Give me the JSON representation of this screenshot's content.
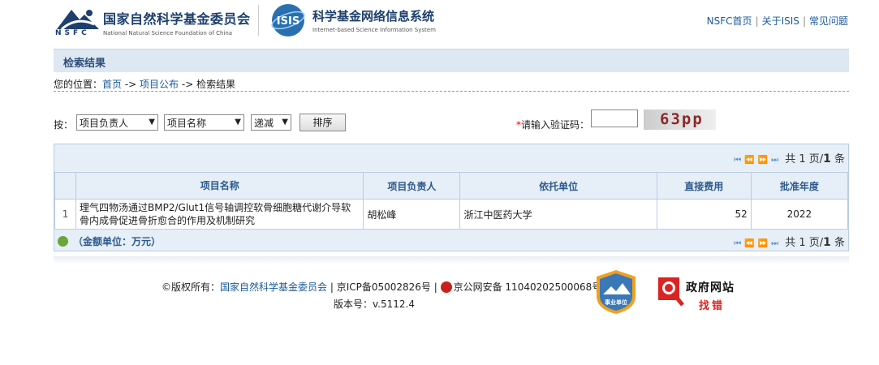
{
  "header": {
    "nsfc_tag": "NSFC",
    "logo1_cn": "国家自然科学基金委员会",
    "logo1_en": "National Natural Science Foundation of China",
    "logo2_cn": "科学基金网络信息系统",
    "logo2_en": "Internet-based Science Information System",
    "logo2_mark": "ISIS",
    "nav": [
      "NSFC首页",
      "关于ISIS",
      "常见问题"
    ]
  },
  "titlebar": "检索结果",
  "breadcrumb": {
    "prefix": "您的位置：",
    "home": "首页",
    "sep1": " -> ",
    "section": "项目公布",
    "sep2": " -> ",
    "current": "检索结果"
  },
  "sort": {
    "label": "按：",
    "select1": "项目负责人",
    "select2": "项目名称",
    "select3": "递减",
    "button": "排序"
  },
  "captcha": {
    "required_mark": "*",
    "label": "请输入验证码：",
    "value": "",
    "image_text": "63pp"
  },
  "pager": {
    "total_text": "共 1 页/",
    "count": "1",
    "unit": " 条",
    "bottom_text": "共 1 页/",
    "bottom_count": "1",
    "bottom_unit": " 条"
  },
  "table": {
    "headers": [
      "项目名称",
      "项目负责人",
      "依托单位",
      "直接费用",
      "批准年度"
    ],
    "rows": [
      {
        "idx": "1",
        "name": "理气四物汤通过BMP2/Glut1信号轴调控软骨细胞糖代谢介导软骨内成骨促进骨折愈合的作用及机制研究",
        "person": "胡松峰",
        "org": "浙江中医药大学",
        "fee": "52",
        "year": "2022"
      }
    ]
  },
  "unit_note": "（金额单位：万元）",
  "footer": {
    "copyright_prefix": "©版权所有：",
    "owner": "国家自然科学基金委员会",
    "icp": " | 京ICP备05002826号 | ",
    "police": "京公网安备 11040202500068号",
    "version_label": "版本号：",
    "version": "v.5112.4",
    "badge1_text": "事业单位",
    "badge2_line1": "政府网站",
    "badge2_line2": "找错"
  }
}
